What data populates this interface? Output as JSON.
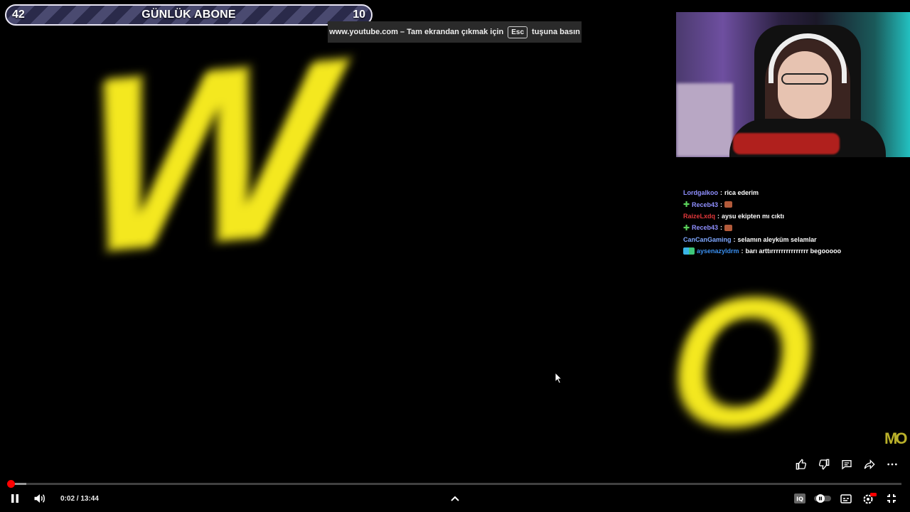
{
  "goal_bar": {
    "current": "42",
    "title": "GÜNLÜK ABONE",
    "target": "10"
  },
  "fullscreen_notice": {
    "before": "www.youtube.com – Tam ekrandan çıkmak için",
    "key": "Esc",
    "after": "tuşuna basın"
  },
  "overlay_letters": [
    "W",
    "O"
  ],
  "chat": [
    {
      "badge": "",
      "user": "Lordgalkoo",
      "user_color": "#8f8fff",
      "sep": " :",
      "message": "rica ederim",
      "emote": false
    },
    {
      "badge": "plus",
      "user": "Receb43",
      "user_color": "#8f8fff",
      "sep": " :",
      "message": "",
      "emote": true
    },
    {
      "badge": "",
      "user": "RaizeLxdq",
      "user_color": "#e0373a",
      "sep": " :",
      "message": "aysu ekipten mı cıktı",
      "emote": false
    },
    {
      "badge": "plus",
      "user": "Receb43",
      "user_color": "#8f8fff",
      "sep": " :",
      "message": "",
      "emote": true
    },
    {
      "badge": "",
      "user": "CanCanGaming",
      "user_color": "#7fa8ff",
      "sep": " :",
      "message": "selamın aleyküm selamlar",
      "emote": false
    },
    {
      "badge": "box",
      "user": "aysenazyldrm",
      "user_color": "#3a8ff0",
      "sep": " :",
      "message": "barı arttırrrrrrrrrrrrrrr begooooo",
      "emote": false
    }
  ],
  "channel_logo": "MO",
  "player": {
    "current_time": "0:02",
    "duration": "13:44",
    "time_text": "0:02 / 13:44",
    "progress_fraction": 0.0024,
    "buffer_fraction": 0.02,
    "progress_color": "#ff0000"
  },
  "icons": {
    "actions": [
      "like-icon",
      "dislike-icon",
      "comment-icon",
      "share-icon",
      "more-icon"
    ],
    "left_controls": [
      "pause-icon",
      "volume-icon"
    ],
    "center_controls": [
      "chevron-up-icon"
    ],
    "right_controls": [
      "iq-icon",
      "autoplay-toggle-icon",
      "subtitles-icon",
      "settings-icon",
      "exit-fullscreen-icon"
    ]
  }
}
